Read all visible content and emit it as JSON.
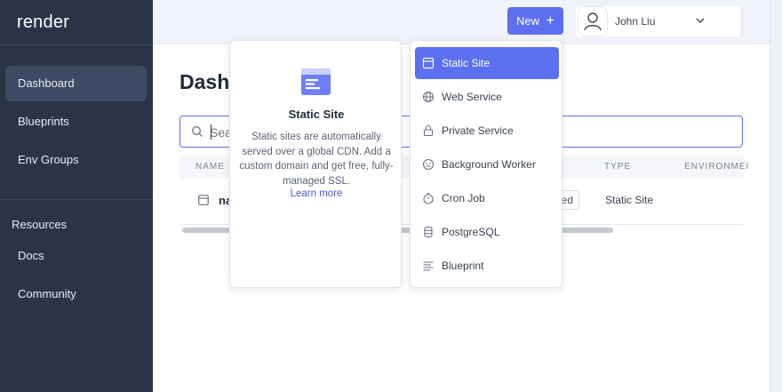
{
  "app": {
    "brand": "render"
  },
  "sidebar": {
    "items": [
      {
        "label": "Dashboard",
        "active": true
      },
      {
        "label": "Blueprints"
      },
      {
        "label": "Env Groups"
      }
    ],
    "section_label": "Resources",
    "resource_items": [
      {
        "label": "Docs"
      },
      {
        "label": "Community"
      }
    ]
  },
  "topbar": {
    "new_label": "New",
    "new_icon": "plus-icon",
    "user_name": "John Liu",
    "user_icon": "user-icon",
    "chevron_icon": "chevron-down-icon"
  },
  "main": {
    "title": "Dashb",
    "search_placeholder": "Sea",
    "columns": [
      "NAME",
      "TYPE",
      "ENVIRONMEI"
    ],
    "rows": [
      {
        "name": "na",
        "status": "ed",
        "type": "Static Site"
      }
    ]
  },
  "info_card": {
    "title": "Static Site",
    "description": "Static sites are automatically served over a global CDN. Add a custom domain and get free, fully-managed SSL.",
    "link": "Learn more",
    "icon": "static-site-icon"
  },
  "new_menu": {
    "items": [
      {
        "label": "Static Site",
        "icon": "browser-window-icon",
        "active": true
      },
      {
        "label": "Web Service",
        "icon": "globe-icon"
      },
      {
        "label": "Private Service",
        "icon": "lock-icon"
      },
      {
        "label": "Background Worker",
        "icon": "worker-icon"
      },
      {
        "label": "Cron Job",
        "icon": "stopwatch-icon"
      },
      {
        "label": "PostgreSQL",
        "icon": "database-icon"
      },
      {
        "label": "Blueprint",
        "icon": "lines-icon"
      }
    ]
  },
  "colors": {
    "sidebar_bg": "#2b3447",
    "accent": "#5b6ff0",
    "topbar_bg": "#f0f3fa"
  }
}
